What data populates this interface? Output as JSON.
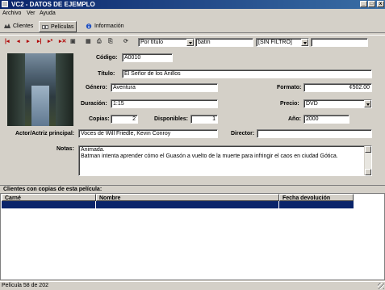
{
  "window": {
    "title": "VC2 - DATOS DE EJEMPLO",
    "controls": {
      "minimize": "_",
      "maximize": "□",
      "close": "x"
    }
  },
  "menu": [
    "Archivo",
    "Ver",
    "Ayuda"
  ],
  "tabs": [
    {
      "label": "Clientes",
      "icon": "clients-icon",
      "active": false
    },
    {
      "label": "Películas",
      "icon": "movies-icon",
      "active": true
    },
    {
      "label": "Información",
      "icon": "info-icon",
      "active": false
    }
  ],
  "toolbar": {
    "nav_icons": [
      "first-icon",
      "previous-icon",
      "next-icon",
      "last-icon",
      "new-icon",
      "delete-icon",
      "save-icon"
    ],
    "action_icons": [
      "grid-icon",
      "print-icon",
      "print-preview-icon",
      "refresh-icon"
    ],
    "search_by": "Por título",
    "search_text": "batm",
    "filter": "[SIN FILTRO]",
    "extra": ""
  },
  "form": {
    "codigo_label": "Código:",
    "codigo": "A0010",
    "titulo_label": "Título:",
    "titulo": "El Señor de los Anillos",
    "genero_label": "Género:",
    "genero": "Aventura",
    "formato_label": "Formato:",
    "formato": "¢502.00",
    "duracion_label": "Duración:",
    "duracion": "1:15",
    "precio_label": "Precio:",
    "precio": "DVD",
    "copias_label": "Copias:",
    "copias": "2",
    "disponibles_label": "Disponibles:",
    "disponibles": "1",
    "anio_label": "Año:",
    "anio": "2000",
    "actor_label": "Actor/Actriz principal:",
    "actor": "Voces de Will Friedle, Kevin Conroy",
    "director_label": "Director:",
    "director": "",
    "notas_label": "Notas:",
    "notas_line1": "Animada.",
    "notas_line2": "Batman intenta aprender cómo el Guasón a vuelto de la muerte para infringir el caos en ciudad Gótica."
  },
  "grid": {
    "caption": "Clientes con copias de esta película:",
    "columns": [
      "Carné",
      "Nombre",
      "Fecha devolución"
    ]
  },
  "status": "Película 58 de 202",
  "colors": {
    "title_bar": "#0a246a",
    "window_bg": "#d4d0c8",
    "selection": "#0a246a",
    "nav_arrows": "#b00000"
  }
}
